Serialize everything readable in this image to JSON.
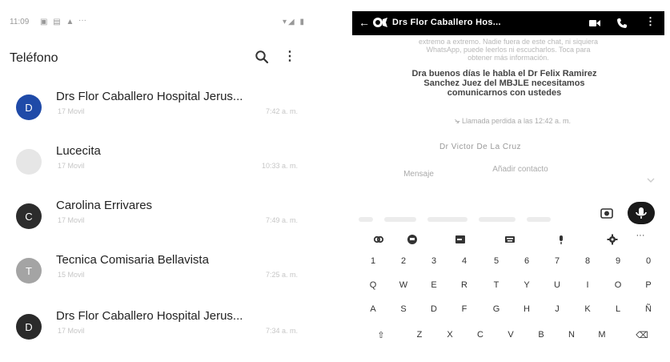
{
  "left_screen": {
    "status": {
      "time": "11:09",
      "icons": "▣ ▤ ▲",
      "more": "···",
      "right": "▾◢ ▮"
    },
    "app_title": "Teléfono",
    "contacts": [
      {
        "initial": "D",
        "name": "Drs Flor Caballero Hospital Jerus...",
        "sub": "17 Movil",
        "time": "7:42 a. m.",
        "avatar_color": "#1f4aa8"
      },
      {
        "initial": "",
        "name": "Lucecita",
        "sub": "17 Movil",
        "time": "10:33 a. m.",
        "avatar_color": "#e6e6e6"
      },
      {
        "initial": "C",
        "name": "Carolina Errivares",
        "sub": "17 Movil",
        "time": "7:49 a. m.",
        "avatar_color": "#2c2c2c"
      },
      {
        "initial": "T",
        "name": "Tecnica Comisaria Bellavista",
        "sub": "15 Movil",
        "time": "7:25 a. m.",
        "avatar_color": "#a4a4a4"
      },
      {
        "initial": "D",
        "name": "Drs Flor Caballero Hospital Jerus...",
        "sub": "17 Movil",
        "time": "7:34 a. m.",
        "avatar_color": "#2a2a2a"
      }
    ]
  },
  "right_screen": {
    "header": {
      "back": "←",
      "title": "Drs Flor Caballero Hos...",
      "more": "⋮"
    },
    "faint_lines": [
      "extremo a extremo. Nadie fuera de este chat, ni siquiera",
      "WhatsApp, puede leerlos ni escucharlos. Toca para",
      "obtener más información."
    ],
    "message": "Dra buenos días le habla el Dr Felix Ramirez Sanchez Juez del MBJLE necesitamos comunicarnos con ustedes",
    "missed_call": "Llamada perdida a las 12:42 a. m.",
    "sender": "Dr Victor De La Cruz",
    "actions": {
      "message_label": "Mensaje",
      "add_contact_label": "Añadir contacto"
    },
    "keyboard": {
      "toolbar_icons": [
        "link-icon",
        "sticker-icon",
        "gif-icon",
        "keyboard-icon",
        "mic-small-icon",
        "gear-icon"
      ],
      "toolbar_more": "···",
      "rows": [
        [
          "1",
          "2",
          "3",
          "4",
          "5",
          "6",
          "7",
          "8",
          "9",
          "0"
        ],
        [
          "Q",
          "W",
          "E",
          "R",
          "T",
          "Y",
          "U",
          "I",
          "O",
          "P"
        ],
        [
          "A",
          "S",
          "D",
          "F",
          "G",
          "H",
          "J",
          "K",
          "L",
          "Ñ"
        ],
        [
          "⇧",
          "Z",
          "X",
          "C",
          "V",
          "B",
          "N",
          "M",
          "⌫"
        ]
      ]
    }
  }
}
